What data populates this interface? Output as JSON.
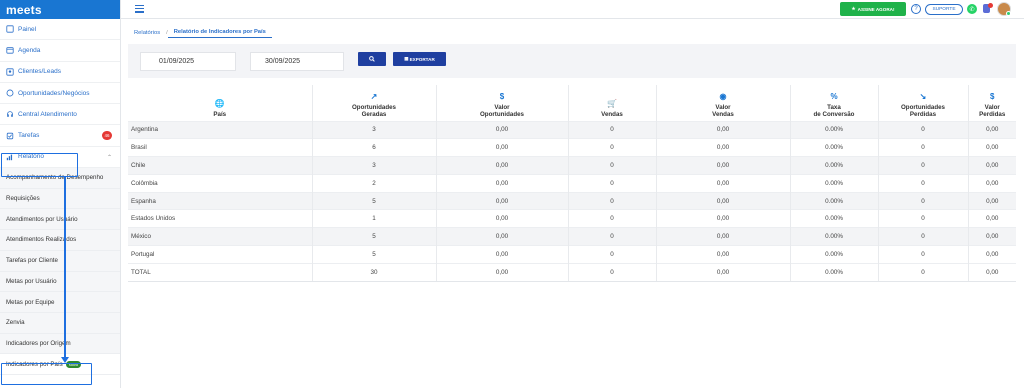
{
  "app": {
    "logo": "meets"
  },
  "sidebar": {
    "items": [
      {
        "label": "Painel",
        "icon": "home-icon"
      },
      {
        "label": "Agenda",
        "icon": "calendar-icon"
      },
      {
        "label": "Clientes/Leads",
        "icon": "contacts-icon"
      },
      {
        "label": "Oportunidades/Negócios",
        "icon": "opportunity-icon"
      },
      {
        "label": "Central Atendimento",
        "icon": "headset-icon"
      },
      {
        "label": "Tarefas",
        "icon": "tasks-icon",
        "badge": "46"
      },
      {
        "label": "Relatório",
        "icon": "chart-icon"
      }
    ],
    "submenu": [
      "Acompanhamento de Desempenho",
      "Requisições",
      "Atendimentos por Usuário",
      "Atendimentos Realizados",
      "Tarefas por Cliente",
      "Metas por Usuário",
      "Metas por Equipe",
      "Zenvia",
      "Indicadores por Origem",
      "Indicadores por País"
    ],
    "new_tag": "Novo"
  },
  "topbar": {
    "assine_label": "ASSINE AGORA!",
    "suporte_label": "SUPORTE"
  },
  "breadcrumb": {
    "parent": "Relatórios",
    "current": "Relatório de Indicadores por País"
  },
  "filters": {
    "date_start": "01/09/2025",
    "date_end": "30/09/2025",
    "export_label": "EXPORTAR"
  },
  "table": {
    "headers": [
      {
        "label": "País",
        "icon": "globe-icon"
      },
      {
        "label": "Oportunidades Geradas",
        "icon": "trend-up-icon"
      },
      {
        "label": "Valor Oportunidades",
        "icon": "dollar-icon"
      },
      {
        "label": "Vendas",
        "icon": "cart-icon"
      },
      {
        "label": "Valor Vendas",
        "icon": "coin-icon"
      },
      {
        "label": "Taxa de Conversão",
        "icon": "percent-icon"
      },
      {
        "label": "Oportunidades Perdidas",
        "icon": "trend-down-icon"
      },
      {
        "label": "Valor Perdidas",
        "icon": "dollar-off-icon"
      }
    ],
    "rows": [
      [
        "Argentina",
        "3",
        "0,00",
        "0",
        "0,00",
        "0.00%",
        "0",
        "0,00"
      ],
      [
        "Brasil",
        "6",
        "0,00",
        "0",
        "0,00",
        "0.00%",
        "0",
        "0,00"
      ],
      [
        "Chile",
        "3",
        "0,00",
        "0",
        "0,00",
        "0.00%",
        "0",
        "0,00"
      ],
      [
        "Colômbia",
        "2",
        "0,00",
        "0",
        "0,00",
        "0.00%",
        "0",
        "0,00"
      ],
      [
        "Espanha",
        "5",
        "0,00",
        "0",
        "0,00",
        "0.00%",
        "0",
        "0,00"
      ],
      [
        "Estados Unidos",
        "1",
        "0,00",
        "0",
        "0,00",
        "0.00%",
        "0",
        "0,00"
      ],
      [
        "México",
        "5",
        "0,00",
        "0",
        "0,00",
        "0.00%",
        "0",
        "0,00"
      ],
      [
        "Portugal",
        "5",
        "0,00",
        "0",
        "0,00",
        "0.00%",
        "0",
        "0,00"
      ],
      [
        "TOTAL",
        "30",
        "0,00",
        "0",
        "0,00",
        "0.00%",
        "0",
        "0,00"
      ]
    ]
  },
  "colors": {
    "primary": "#1976d2",
    "accent_green": "#1fb24a",
    "button_dark": "#1f3fa0",
    "highlight": "#1e6fe0"
  }
}
